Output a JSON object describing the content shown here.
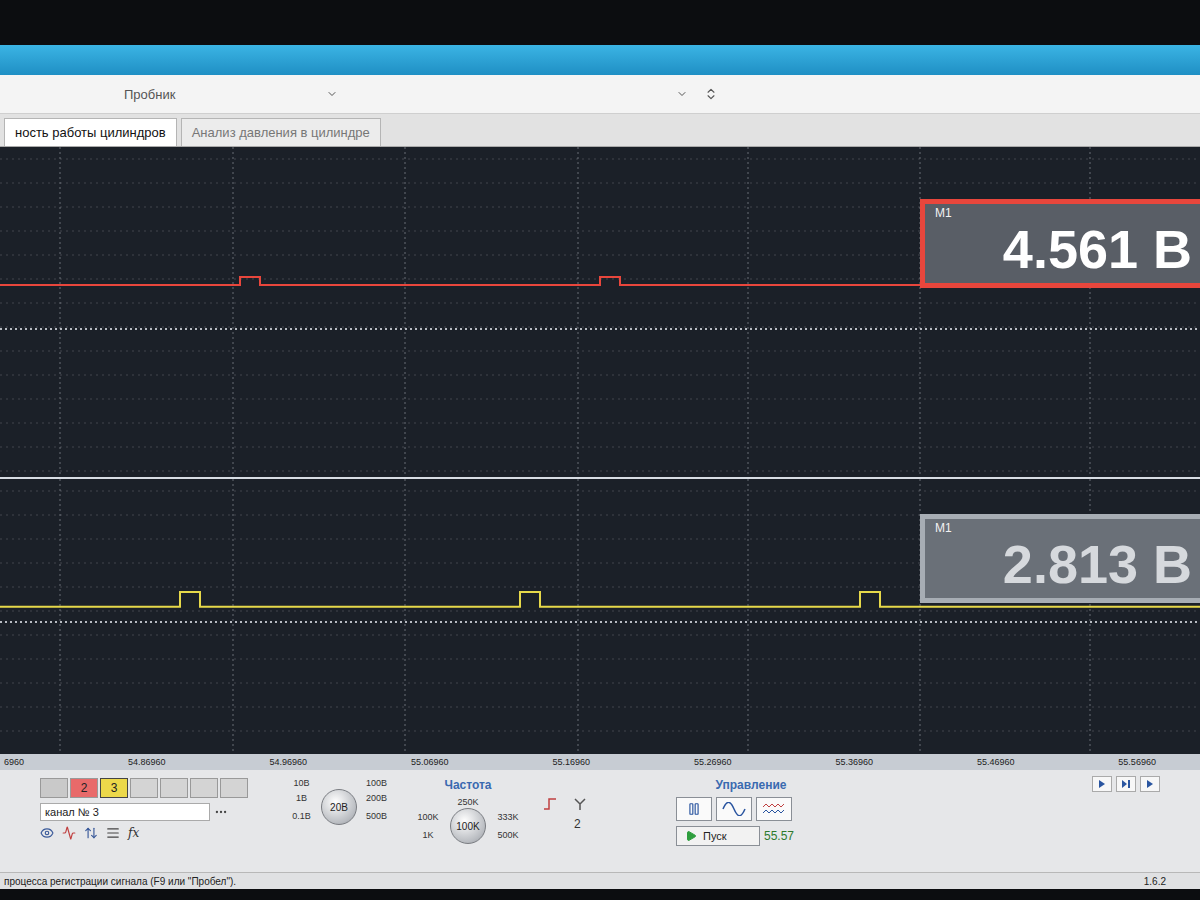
{
  "toolbar": {
    "probe_label": "Пробник"
  },
  "tabs": [
    {
      "label": "ность работы цилиндров",
      "selected": true
    },
    {
      "label": "Анализ давления в цилиндре",
      "selected": false
    }
  ],
  "channels": [
    {
      "name": "upper",
      "marker": "M1",
      "reading": "4.561 В",
      "readout_active": true,
      "color": "#e8463c",
      "values": [
        4.561,
        4.561,
        4.561,
        4.561,
        4.561,
        4.561,
        4.561,
        4.561,
        4.561,
        4.561,
        4.561,
        4.561,
        4.9,
        4.561,
        4.561,
        4.561,
        4.561,
        4.561,
        4.561,
        4.561,
        4.561,
        4.561,
        4.561,
        4.561,
        4.561,
        4.561,
        4.561,
        4.561,
        4.561,
        4.561,
        4.9,
        4.561,
        4.561,
        4.561,
        4.561,
        4.561,
        4.561,
        4.561,
        4.561,
        4.561,
        4.561,
        4.561,
        4.561,
        4.561,
        4.561,
        4.561,
        4.561,
        4.561,
        4.561,
        4.561,
        4.561,
        4.561,
        4.561,
        4.561,
        4.561,
        4.561,
        4.561,
        4.561,
        4.561,
        4.561
      ]
    },
    {
      "name": "lower",
      "marker": "M1",
      "reading": "2.813 В",
      "readout_active": false,
      "color": "#e6d84a",
      "values": [
        2.813,
        2.813,
        2.813,
        2.813,
        2.813,
        2.813,
        2.813,
        2.813,
        2.813,
        3.4,
        2.813,
        2.813,
        2.813,
        2.813,
        2.813,
        2.813,
        2.813,
        2.813,
        2.813,
        2.813,
        2.813,
        2.813,
        2.813,
        2.813,
        2.813,
        2.813,
        3.4,
        2.813,
        2.813,
        2.813,
        2.813,
        2.813,
        2.813,
        2.813,
        2.813,
        2.813,
        2.813,
        2.813,
        2.813,
        2.813,
        2.813,
        2.813,
        2.813,
        3.4,
        2.813,
        2.813,
        2.813,
        2.813,
        2.813,
        2.813,
        2.813,
        2.813,
        2.813,
        2.813,
        2.813,
        2.813,
        2.813,
        2.813,
        2.813,
        2.813
      ]
    }
  ],
  "time_axis": {
    "ticks": [
      "6960",
      "54.86960",
      "54.96960",
      "55.06960",
      "55.16960",
      "55.26960",
      "55.36960",
      "55.46960",
      "55.56960"
    ]
  },
  "controls": {
    "channel_buttons": [
      {
        "label": "",
        "selected": false,
        "color": "#c9c9c9"
      },
      {
        "label": "2",
        "selected": false,
        "color": "#e86a6a"
      },
      {
        "label": "3",
        "selected": true,
        "color": "#ecd84a"
      },
      {
        "label": "",
        "selected": false,
        "color": "#d4d4d4"
      },
      {
        "label": "",
        "selected": false,
        "color": "#d4d4d4"
      },
      {
        "label": "",
        "selected": false,
        "color": "#d4d4d4"
      },
      {
        "label": "",
        "selected": false,
        "color": "#d4d4d4"
      }
    ],
    "channel_select": "канал № 3",
    "formula_button": "fx",
    "scale": {
      "ticks": [
        "10В",
        "100В",
        "1В",
        "200В",
        "0.1В",
        "500В"
      ],
      "value": "20В"
    },
    "frequency": {
      "title": "Частота",
      "ticks": [
        "250K",
        "100K",
        "333K",
        "1K",
        "500K"
      ],
      "value": "100K"
    },
    "trigger_level": "2",
    "control_title": "Управление",
    "start_button": "Пуск",
    "time": "55.57"
  },
  "status_bar": {
    "text": "процесса регистрации сигнала (F9 или \"Пробел\").",
    "version": "1.6.2"
  }
}
